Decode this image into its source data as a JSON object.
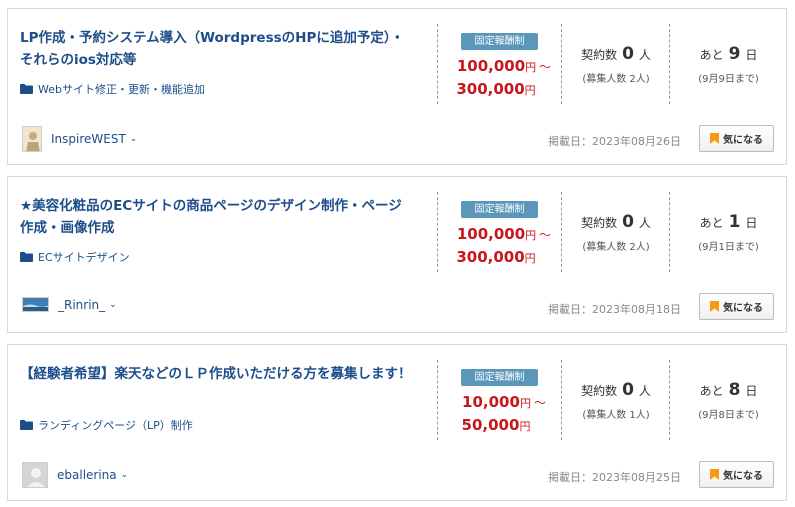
{
  "common": {
    "badge": "固定報酬制",
    "yen": "円",
    "tilde": "〜",
    "contract_label": "契約数",
    "person_unit": "人",
    "days_label": "あと",
    "days_unit": "日",
    "posted_prefix": "掲載日：",
    "bookmark_label": "気になる",
    "chevron": "⌄"
  },
  "jobs": [
    {
      "title": "LP作成・予約システム導入（WordpressのHPに追加予定）・それらのios対応等",
      "category": "Webサイト修正・更新・機能追加",
      "price_min": "100,000",
      "price_max": "300,000",
      "contracts": "0",
      "recruit": "(募集人数 2人)",
      "days_left": "9",
      "deadline": "(9月9日まで)",
      "username": "InspireWEST",
      "posted": "2023年08月26日"
    },
    {
      "title": "★美容化粧品のECサイトの商品ページのデザイン制作・ページ作成・画像作成",
      "category": "ECサイトデザイン",
      "price_min": "100,000",
      "price_max": "300,000",
      "contracts": "0",
      "recruit": "(募集人数 2人)",
      "days_left": "1",
      "deadline": "(9月1日まで)",
      "username": "_Rinrin_",
      "posted": "2023年08月18日"
    },
    {
      "title": "【経験者希望】楽天などのＬＰ作成いただける方を募集します！",
      "category": "ランディングページ（LP）制作",
      "price_min": "10,000",
      "price_max": "50,000",
      "contracts": "0",
      "recruit": "(募集人数 1人)",
      "days_left": "8",
      "deadline": "(9月8日まで)",
      "username": "eballerina",
      "posted": "2023年08月25日"
    }
  ],
  "colors": {
    "title": "#1d4d8a",
    "price": "#c8161d",
    "badge": "#5a97b8",
    "bookmark_icon": "#f39c12"
  }
}
